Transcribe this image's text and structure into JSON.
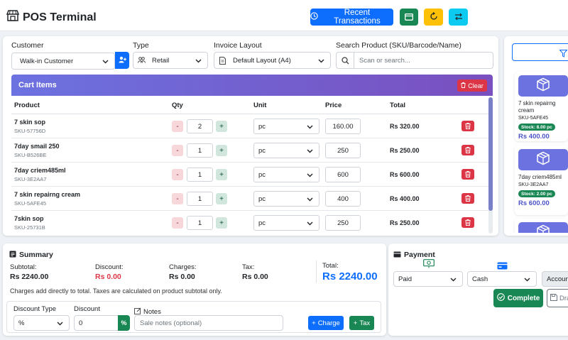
{
  "header": {
    "title": "POS Terminal",
    "recent_label": "Recent Transactions"
  },
  "filters": {
    "customer_label": "Customer",
    "customer_value": "Walk-in Customer",
    "type_label": "Type",
    "type_value": "Retail",
    "layout_label": "Invoice Layout",
    "layout_value": "Default Layout (A4)",
    "search_label": "Search Product (SKU/Barcode/Name)",
    "search_placeholder": "Scan or search..."
  },
  "cart": {
    "title": "Cart Items",
    "clear_label": "Clear",
    "columns": {
      "product": "Product",
      "qty": "Qty",
      "unit": "Unit",
      "price": "Price",
      "total": "Total"
    },
    "items": [
      {
        "name": "7 skin sop",
        "sku": "SKU-57756D",
        "qty": "2",
        "unit": "pc",
        "price": "160.00",
        "total": "Rs 320.00"
      },
      {
        "name": "7day smail 250",
        "sku": "SKU-B526BE",
        "qty": "1",
        "unit": "pc",
        "price": "250",
        "total": "Rs 250.00"
      },
      {
        "name": "7day criem485ml",
        "sku": "SKU-3E2AA7",
        "qty": "1",
        "unit": "pc",
        "price": "600",
        "total": "Rs 600.00"
      },
      {
        "name": "7 skin repairng cream",
        "sku": "SKU-5AFE45",
        "qty": "1",
        "unit": "pc",
        "price": "400",
        "total": "Rs 400.00"
      },
      {
        "name": "7skin sop",
        "sku": "SKU-25731B",
        "qty": "1",
        "unit": "pc",
        "price": "250",
        "total": "Rs 250.00"
      }
    ],
    "minus": "-",
    "plus": "+"
  },
  "products": [
    {
      "name": "7 skin repairng cream",
      "sku": "SKU-5AFE45",
      "stock": "Stock: 8.00 pc",
      "price": "Rs 400.00"
    },
    {
      "name": "7day criem485ml",
      "sku": "SKU-3E2AA7",
      "stock": "Stock: 2.00 pc",
      "price": "Rs 600.00"
    }
  ],
  "summary": {
    "title": "Summary",
    "subtotal_label": "Subtotal:",
    "subtotal_value": "Rs 2240.00",
    "discount_label": "Discount:",
    "discount_value": "Rs 0.00",
    "charges_label": "Charges:",
    "charges_value": "Rs 0.00",
    "tax_label": "Tax:",
    "tax_value": "Rs 0.00",
    "total_label": "Total:",
    "total_value": "Rs 2240.00",
    "note": "Charges add directly to total. Taxes are calculated on product subtotal only.",
    "discount_type_label": "Discount Type",
    "discount_type_value": "%",
    "discount_label2": "Discount",
    "discount_input": "0",
    "discount_suffix": "%",
    "notes_label": "Notes",
    "notes_placeholder": "Sale notes (optional)",
    "charge_btn": "Charge",
    "tax_btn": "Tax"
  },
  "payment": {
    "title": "Payment",
    "status_value": "Paid",
    "method_value": "Cash",
    "account_label": "Account",
    "complete_label": "Complete",
    "draft_label": "Dra"
  },
  "colors": {
    "primary": "#0d6efd",
    "success": "#198754",
    "danger": "#dc3545",
    "cart_header": "#6c72e0"
  }
}
